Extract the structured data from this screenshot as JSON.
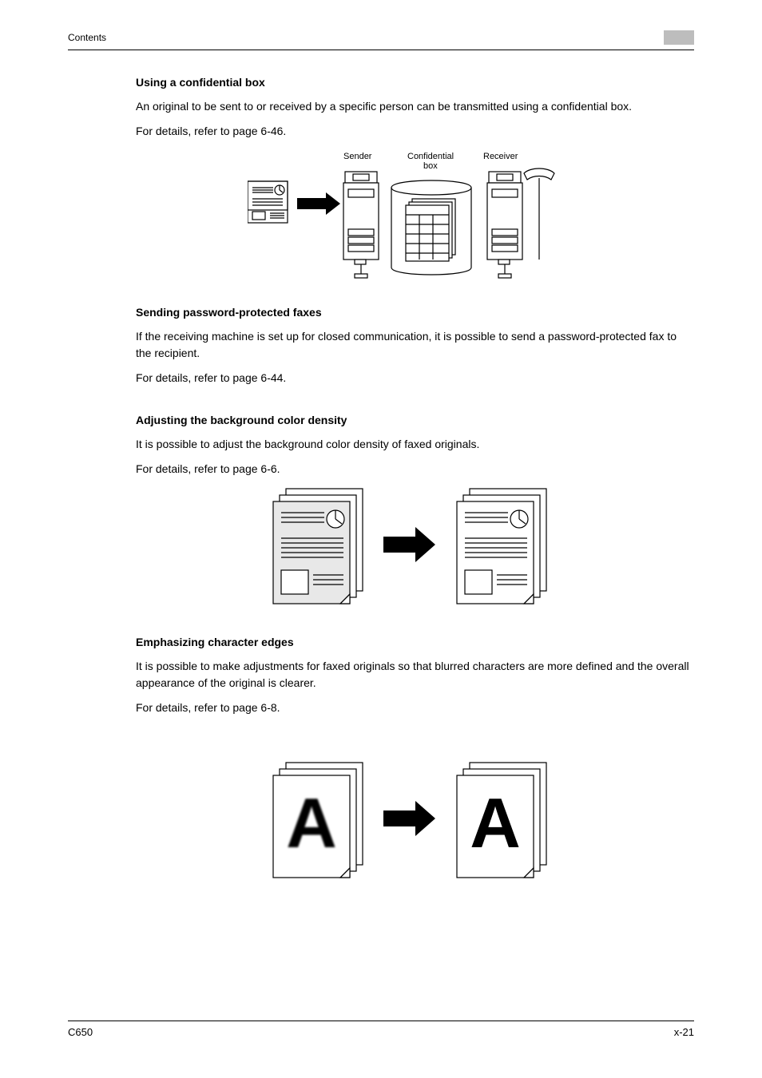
{
  "header": {
    "title": "Contents"
  },
  "sections": {
    "s1": {
      "title": "Using a confidential box",
      "p1": "An original to be sent to or received by a specific person can be transmitted using a confidential box.",
      "p2": "For details, refer to page 6-46."
    },
    "diagram1": {
      "sender": "Sender",
      "confbox": "Confidential box",
      "receiver": "Receiver"
    },
    "s2": {
      "title": "Sending password-protected faxes",
      "p1": "If the receiving machine is set up for closed communication, it is possible to send a password-protected fax to the recipient.",
      "p2": "For details, refer to page 6-44."
    },
    "s3": {
      "title": "Adjusting the background color density",
      "p1": "It is possible to adjust the background color density of faxed originals.",
      "p2": "For details, refer to page 6-6."
    },
    "s4": {
      "title": "Emphasizing character edges",
      "p1": "It is possible to make adjustments for faxed originals so that blurred characters are more defined and the overall appearance of the original is clearer.",
      "p2": "For details, refer to page 6-8."
    },
    "bigA": "A"
  },
  "footer": {
    "left": "C650",
    "right": "x-21"
  }
}
